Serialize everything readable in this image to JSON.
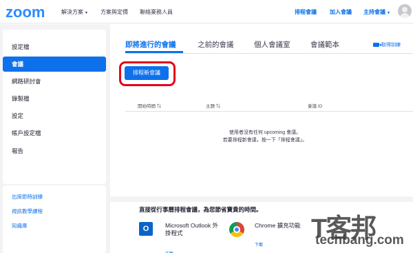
{
  "header": {
    "logo": "zoom",
    "nav": [
      "解決方案",
      "方案與定價",
      "聯絡業務人員"
    ],
    "right_links": [
      "排程會議",
      "加入會議",
      "主持會議"
    ]
  },
  "sidebar": {
    "items": [
      {
        "label": "設定檔",
        "active": false
      },
      {
        "label": "會議",
        "active": true
      },
      {
        "label": "網路研討會",
        "active": false
      },
      {
        "label": "錄製檔",
        "active": false
      },
      {
        "label": "設定",
        "active": false
      },
      {
        "label": "帳戶設定檔",
        "active": false
      },
      {
        "label": "報告",
        "active": false
      }
    ],
    "links": [
      "出席即時訓練",
      "視訊教學課程",
      "知識庫"
    ]
  },
  "main": {
    "tabs": [
      "即將進行的會議",
      "之前的會議",
      "個人會議室",
      "會議範本"
    ],
    "right_link": "取得訓練",
    "schedule_button": "排程新會議",
    "table_headers": [
      "開始時間",
      "主題",
      "會議 ID"
    ],
    "empty_line1": "使用者沒有任何 upcoming 會議。",
    "empty_line2": "若要排程新會議，按一下「排程會議」。",
    "calendar_heading": "直接從行事曆排程會議，為您節省寶貴的時間。",
    "outlook_title": "Microsoft Outlook 外掛程式",
    "chrome_title": "Chrome 擴充功能",
    "download": "下載"
  },
  "watermark": {
    "cjk": "T客邦",
    "latin": "techbang.com"
  },
  "colors": {
    "accent": "#0e71eb",
    "highlight": "#e2001a",
    "sidebar_bg": "#f3f3f5"
  }
}
